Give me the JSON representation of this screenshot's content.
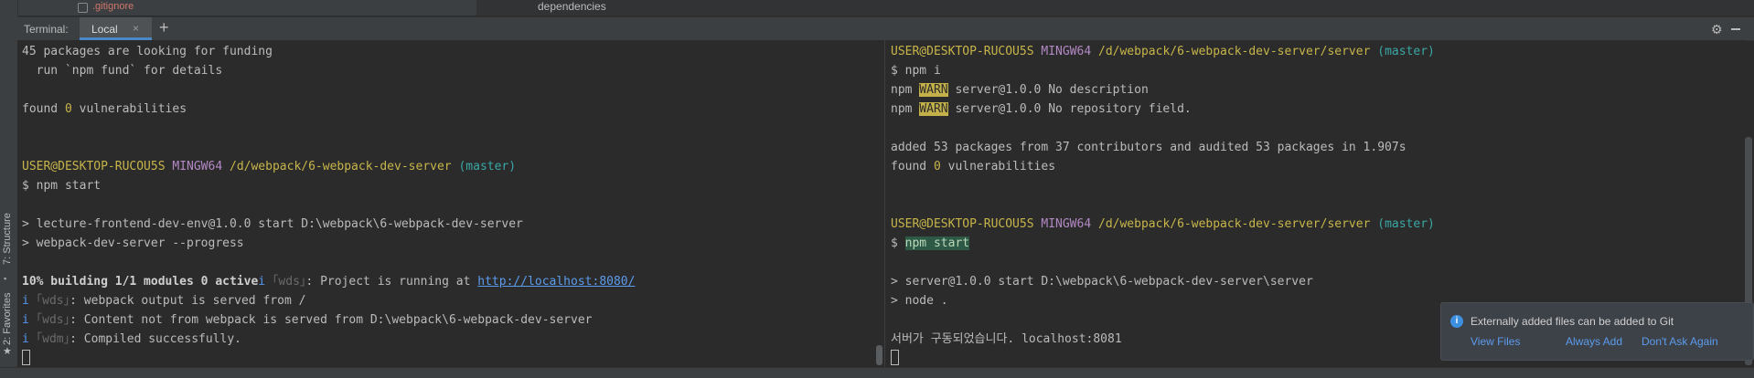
{
  "colors": {
    "accent": "#4a88c7",
    "user": "#c7b54a",
    "mingw": "#b389c5",
    "branch": "#3aa7a5",
    "link": "#5c9ced",
    "warn": "#c5b14a"
  },
  "file_tree": {
    "gitignore": ".gitignore",
    "dependencies": "dependencies"
  },
  "left_gutter": {
    "structure_tab": "7: Structure",
    "favorites_tab": "2: Favorites"
  },
  "terminal_bar": {
    "label": "Terminal:",
    "tab_local": "Local",
    "tab_close": "×",
    "add_tab": "+",
    "gear": "⚙"
  },
  "left_pane": {
    "l1": "45 packages are looking for funding",
    "l2": "  run `npm fund` for details",
    "l4_a": "found ",
    "l4_zero": "0",
    "l4_b": " vulnerabilities",
    "prompt_user": "USER@DESKTOP-RUCOU5S",
    "prompt_mingw": "MINGW64",
    "prompt_path": "/d/webpack/6-webpack-dev-server",
    "prompt_branch": "(master)",
    "cmd": "$ npm start",
    "out1": "> lecture-frontend-dev-env@1.0.0 start D:\\webpack\\6-webpack-dev-server",
    "out2": "> webpack-dev-server --progress",
    "build_bold": "10% building 1/1 modules 0 active",
    "build_i": "i",
    "build_wds": " ｢wds｣",
    "build_msg": ": Project is running at ",
    "build_url": "http://localhost:8080/",
    "w1_i": "i",
    "w1_tag": " ｢wds｣",
    "w1_msg": ": webpack output is served from /",
    "w2_i": "i",
    "w2_tag": " ｢wds｣",
    "w2_msg": ": Content not from webpack is served from D:\\webpack\\6-webpack-dev-server",
    "w3_i": "i",
    "w3_tag": " ｢wdm｣",
    "w3_msg": ": Compiled successfully."
  },
  "right_pane": {
    "prompt_user": "USER@DESKTOP-RUCOU5S",
    "prompt_mingw": "MINGW64",
    "prompt_path": "/d/webpack/6-webpack-dev-server/server",
    "prompt_branch": "(master)",
    "cmd1": "$ npm i",
    "warn1_a": "npm ",
    "warn1_tag": "WARN",
    "warn1_b": " server@1.0.0 No description",
    "warn2_a": "npm ",
    "warn2_tag": "WARN",
    "warn2_b": " server@1.0.0 No repository field.",
    "added": "added 53 packages from 37 contributors and audited 53 packages in 1.907s",
    "found_a": "found ",
    "found_zero": "0",
    "found_b": " vulnerabilities",
    "cmd2_prefix": "$ ",
    "cmd2": "npm start",
    "out1": "> server@1.0.0 start D:\\webpack\\6-webpack-dev-server\\server",
    "out2": "> node .",
    "korean": "서버가 구동되었습니다. localhost:8081"
  },
  "notification": {
    "message": "Externally added files can be added to Git",
    "view_files": "View Files",
    "always_add": "Always Add",
    "dont_ask": "Don't Ask Again"
  }
}
